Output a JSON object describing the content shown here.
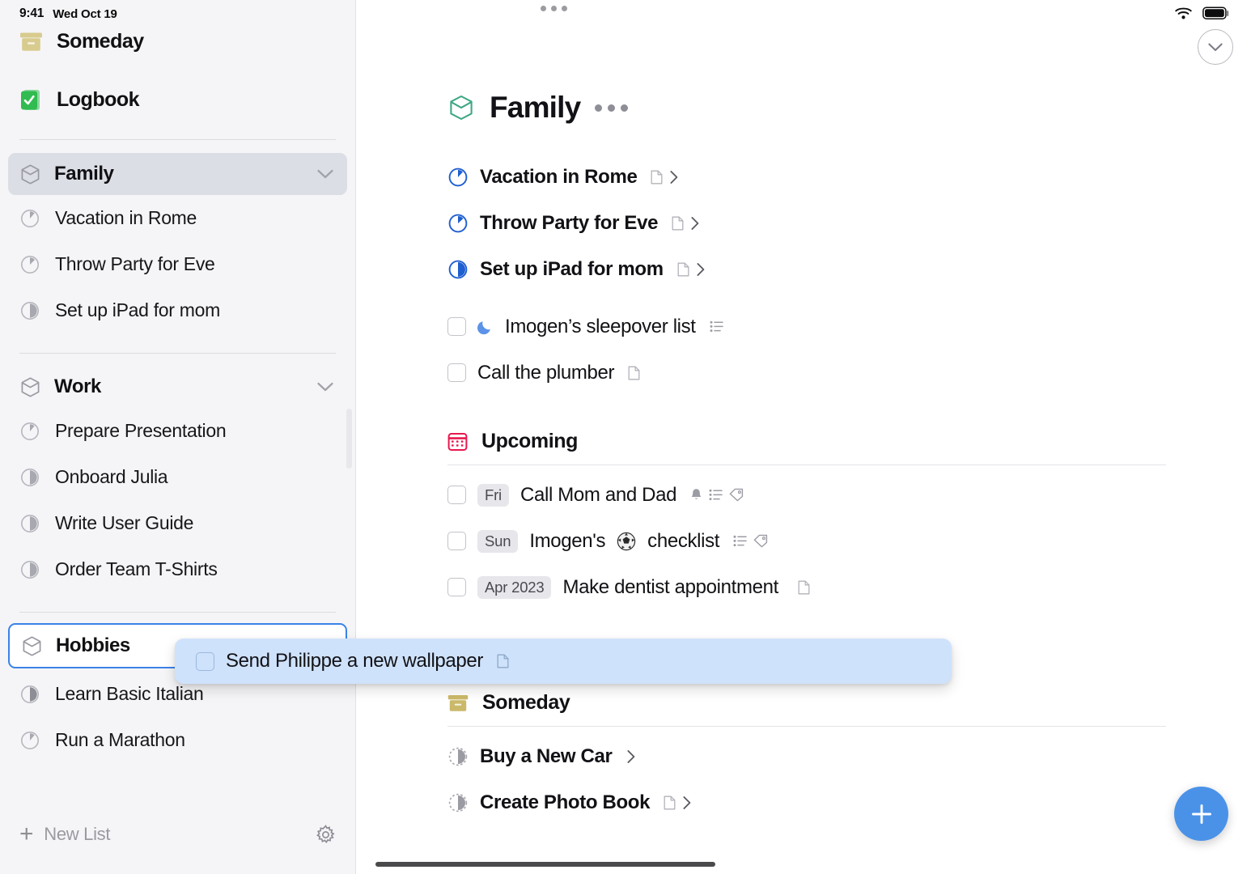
{
  "status_bar": {
    "time": "9:41",
    "date": "Wed Oct 19",
    "wifi_icon": "wifi-icon",
    "battery_icon": "battery-icon"
  },
  "sidebar": {
    "top_items": [
      {
        "label": "Someday",
        "icon": "archive-box-icon"
      },
      {
        "label": "Logbook",
        "icon": "logbook-check-icon"
      }
    ],
    "groups": [
      {
        "label": "Family",
        "icon": "area-hexagon-icon",
        "state": "selected",
        "chevron": "chevron-down-icon",
        "projects": [
          {
            "label": "Vacation in Rome",
            "progress": 10
          },
          {
            "label": "Throw Party for Eve",
            "progress": 12
          },
          {
            "label": "Set up iPad for mom",
            "progress": 50
          }
        ]
      },
      {
        "label": "Work",
        "icon": "area-hexagon-icon",
        "state": "normal",
        "chevron": "chevron-down-icon",
        "projects": [
          {
            "label": "Prepare Presentation",
            "progress": 10
          },
          {
            "label": "Onboard Julia",
            "progress": 50
          },
          {
            "label": "Write User Guide",
            "progress": 50
          },
          {
            "label": "Order Team T-Shirts",
            "progress": 50
          }
        ]
      },
      {
        "label": "Hobbies",
        "icon": "area-hexagon-icon",
        "state": "drop-target",
        "chevron": "",
        "projects": [
          {
            "label": "Learn Basic Italian",
            "progress": 50
          },
          {
            "label": "Run a Marathon",
            "progress": 10
          }
        ]
      }
    ],
    "footer": {
      "new_list_label": "New List",
      "plus_icon": "plus-icon",
      "settings_icon": "gear-icon"
    }
  },
  "main": {
    "window_dots_icon": "window-dots-icon",
    "collapse_icon": "chevron-down-circle-icon",
    "header": {
      "title": "Family",
      "icon": "area-hexagon-icon",
      "more_icon": "more-dots-icon"
    },
    "top_items": [
      {
        "type": "project",
        "label": "Vacation in Rome",
        "progress": 12,
        "icons": [
          "note-icon",
          "chevron-right-icon"
        ]
      },
      {
        "type": "project",
        "label": "Throw Party for Eve",
        "progress": 12,
        "icons": [
          "note-icon",
          "chevron-right-icon"
        ]
      },
      {
        "type": "project",
        "label": "Set up iPad for mom",
        "progress": 50,
        "icons": [
          "note-icon",
          "chevron-right-icon"
        ]
      },
      {
        "type": "todo",
        "label": "Imogen’s sleepover list",
        "lead_icon": "evening-moon-icon",
        "icons": [
          "checklist-icon"
        ]
      },
      {
        "type": "todo",
        "label": "Call the plumber",
        "lead_icon": "",
        "icons": [
          "note-icon"
        ]
      }
    ],
    "sections": [
      {
        "title": "Upcoming",
        "icon": "calendar-icon",
        "icon_color": "#e8174e",
        "items": [
          {
            "type": "todo",
            "badge": "Fri",
            "label": "Call Mom and Dad",
            "icons": [
              "reminder-bell-icon",
              "checklist-icon",
              "tag-icon"
            ]
          },
          {
            "type": "todo",
            "badge": "Sun",
            "label_before": "Imogen's",
            "emoji": "soccer-ball-icon",
            "label_after": "checklist",
            "icons": [
              "checklist-icon",
              "tag-icon"
            ]
          },
          {
            "type": "todo",
            "badge": "Apr 2023",
            "label": "Make dentist appointment",
            "icons": [
              "note-icon"
            ]
          }
        ]
      },
      {
        "title": "Someday",
        "icon": "archive-box-icon",
        "icon_color": "#cbb96a",
        "items": [
          {
            "type": "project-someday",
            "label": "Buy a New Car",
            "progress": 50,
            "icons": [
              "chevron-right-icon"
            ]
          },
          {
            "type": "project-someday",
            "label": "Create Photo Book",
            "progress": 50,
            "icons": [
              "note-icon",
              "chevron-right-icon"
            ]
          }
        ]
      }
    ],
    "dragged_item": {
      "label": "Send Philippe a new wallpaper",
      "icons": [
        "note-icon"
      ],
      "checkbox": "unchecked"
    },
    "add_button": {
      "icon": "plus-icon",
      "label": ""
    }
  },
  "colors": {
    "accent_blue": "#4a92e8",
    "project_blue": "#1f5fd0",
    "drag_card_bg": "#cfe2fb",
    "sidebar_bg": "#f5f5f7",
    "selected_row": "#dcdee5",
    "upcoming_red": "#e8174e",
    "someday_tan": "#cbb96a",
    "logbook_green": "#31bb50",
    "family_green": "#3fa882"
  }
}
